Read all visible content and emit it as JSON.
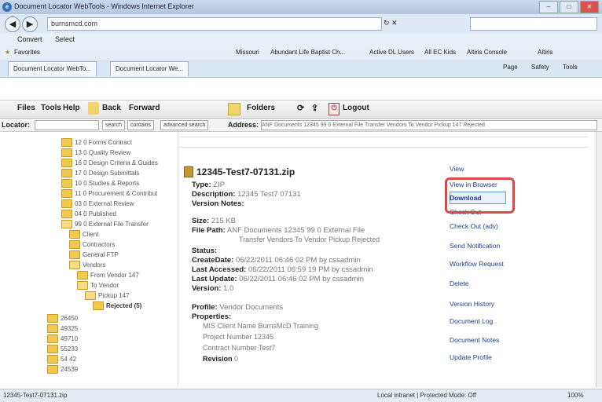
{
  "window": {
    "title": "Document Locator WebTools - Windows Internet Explorer",
    "url": "burnsmcd.com"
  },
  "browser": {
    "menu": [
      "Convert",
      "Select"
    ],
    "favorites_label": "Favorites",
    "favorites_links": [
      "Missouri",
      "Abundant Life Baptist Ch...",
      "Active DL Users",
      "All EC Kids",
      "Altiris Console",
      "Altiris"
    ],
    "tabs": [
      "Document Locator WebTo...",
      "Document Locator We..."
    ],
    "tab_tools": [
      "Page",
      "Safety",
      "Tools"
    ]
  },
  "app": {
    "toolbar": [
      "Files",
      "Tools",
      "Help",
      "Back",
      "Forward",
      "Folders",
      "Logout"
    ],
    "locator_label": "Locator:",
    "locator_buttons": [
      "search",
      "contains",
      "advanced search"
    ],
    "address_label": "Address:",
    "address_value": "ANF Documents 12345 99 0 External File Transfer Vendors To Vendor Pickup 147 Rejected"
  },
  "tree": [
    "12 0 Forms Contract",
    "13 0 Quality Review",
    "16 0 Design Criteria & Guides",
    "17 0 Design Submittals",
    "10 0 Studies & Reports",
    "11 0 Procurement & Contribut",
    "03 0 External Review",
    "04 0 Published",
    "99 0 External File Transfer",
    "Client",
    "Contractors",
    "General FTP",
    "Vendors",
    "From Vendor 147",
    "To Vendor",
    "Pickup 147",
    "Rejected (5)",
    "26450",
    "49325",
    "49710",
    "55233",
    "54 42",
    "24539"
  ],
  "detail": {
    "file_name": "12345-Test7-07131.zip",
    "type_label": "Type:",
    "type_value": "ZIP",
    "description_label": "Description:",
    "description_value": "12345 Test7 07131",
    "version_notes_label": "Version Notes:",
    "size_label": "Size:",
    "size_value": "215 KB",
    "file_path_label": "File Path:",
    "file_path_value": "ANF Documents 12345 99 0 External File",
    "file_path_value2": "Transfer Vendors To Vendor Pickup Rejected",
    "status_label": "Status:",
    "create_label": "CreateDate:",
    "create_value": "06/22/2011 06:46 02 PM by cssadmin",
    "accessed_label": "Last Accessed:",
    "accessed_value": "06/22/2011 06:59 19 PM by cssadmin",
    "update_label": "Last Update:",
    "update_value": "06/22/2011 06:46 02 PM by cssadmin",
    "version_label": "Version:",
    "version_value": "1.0",
    "profile_label": "Profile:",
    "profile_value": "Vendor Documents",
    "properties_label": "Properties:",
    "prop1": "MIS Client Name   BurnsMcD Training",
    "prop2": "Project Number   12345",
    "prop3": "Contract Number   Test7",
    "revision_label": "Revision",
    "revision_value": "0"
  },
  "actions": [
    "View",
    "View in Browser",
    "Download",
    "Check Out",
    "Check Out (adv)",
    "Send Notification",
    "Workflow Request",
    "Delete",
    "Version History",
    "Document Log",
    "Document Notes",
    "Update Profile"
  ],
  "status": {
    "left": "12345-Test7-07131.zip",
    "zone": "Local intranet | Protected Mode: Off",
    "zoom": "100%"
  }
}
